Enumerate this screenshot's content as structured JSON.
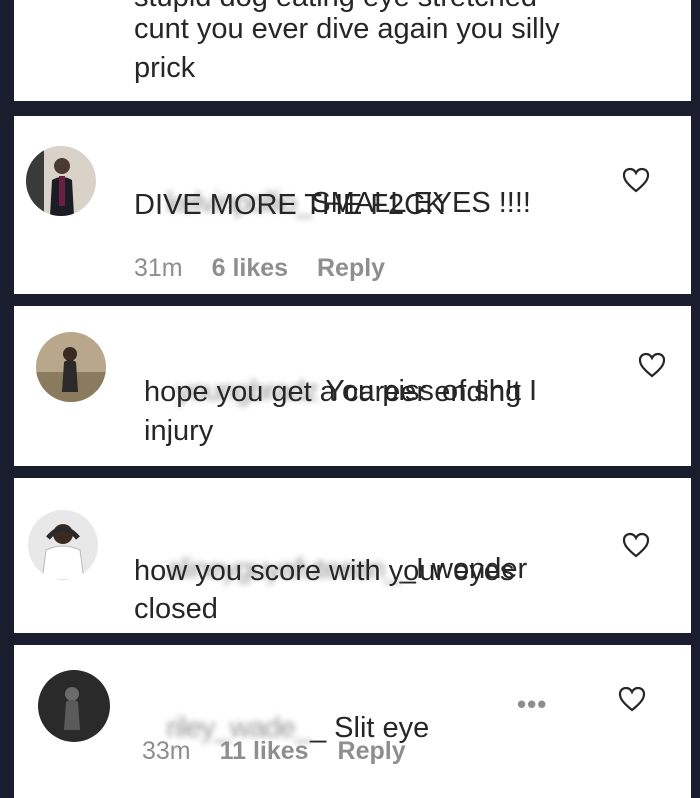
{
  "comments": [
    {
      "partial_line": "stupid dog eating eye stretched",
      "text_line1": "cunt you ever dive again you silly",
      "text_line2": "prick"
    },
    {
      "username": "kelvinpollio_",
      "text_line1": "SMALL EYES !!!!",
      "text_line2": "DIVE MORE THE F2CK",
      "time": "31m",
      "likes": "6 likes",
      "reply": "Reply"
    },
    {
      "username": "youngbradz",
      "text_line1": "You piss of sh!t I",
      "text_line2": "hope you get a career ending",
      "text_line3": "injury"
    },
    {
      "username": "alineyguyafuteean_",
      "text_line1": "_I wonder",
      "text_line2": "how you score with your eyes",
      "text_line3": "closed"
    },
    {
      "username": "riley_wade_",
      "text_line1": "_ Slit eye",
      "time": "33m",
      "likes": "11 likes",
      "reply": "Reply",
      "more": "•••"
    }
  ],
  "icons": {
    "heart": "heart-outline-icon",
    "more": "more-options-icon"
  },
  "colors": {
    "background": "#1a1d2e",
    "card": "#ffffff",
    "text": "#262626",
    "muted": "#8e8e8e"
  }
}
